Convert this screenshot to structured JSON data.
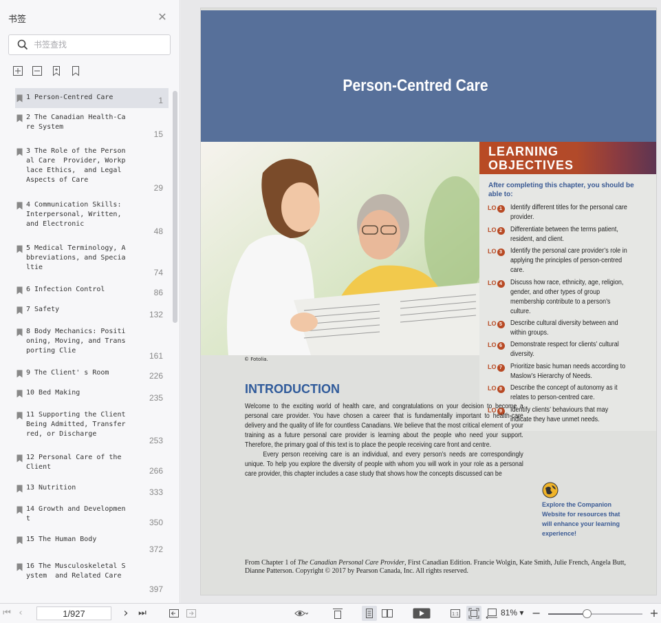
{
  "sidebar": {
    "title": "书签",
    "search_placeholder": "书签查找",
    "bookmarks": [
      {
        "label": "1 Person-Centred Care",
        "page": "1",
        "active": true,
        "h": 29
      },
      {
        "label": "2 The Canadian Health-Ca\nre System",
        "page": "15",
        "h": 49
      },
      {
        "label": "3 The Role of the Person\nal Care  Provider, Workp\nlace Ethics,  and Legal\nAspects of Care",
        "page": "29",
        "h": 78
      },
      {
        "label": "4 Communication Skills:\nInterpersonal, Written,\nand Electronic",
        "page": "48",
        "h": 63
      },
      {
        "label": "5 Medical Terminology, A\nbbreviations, and Specia\nltie",
        "page": "74",
        "h": 60
      },
      {
        "label": "6 Infection Control",
        "page": "86",
        "h": 29
      },
      {
        "label": "7 Safety",
        "page": "132",
        "h": 32
      },
      {
        "label": "8 Body Mechanics: Positi\noning, Moving, and Trans\nporting Clie",
        "page": "161",
        "h": 60
      },
      {
        "label": "9 The Client' s Room",
        "page": "226",
        "h": 29
      },
      {
        "label": "10 Bed Making",
        "page": "235",
        "h": 32
      },
      {
        "label": "11 Supporting the Client\nBeing Admitted, Transfer\nred, or Discharge",
        "page": "253",
        "h": 62
      },
      {
        "label": "12 Personal Care of the\nClient",
        "page": "266",
        "h": 44
      },
      {
        "label": "13 Nutrition",
        "page": "333",
        "h": 31
      },
      {
        "label": "14 Growth and Developmen\nt",
        "page": "350",
        "h": 44
      },
      {
        "label": "15 The Human Body",
        "page": "372",
        "h": 39
      },
      {
        "label": "16 The Musculoskeletal S\nystem  and Related Care",
        "page": "397",
        "h": 58
      }
    ]
  },
  "document": {
    "title": "Person-Centred Care",
    "photo_credit": "© Fotolia.",
    "objectives": {
      "heading_line1": "LEARNING",
      "heading_line2": "OBJECTIVES",
      "intro": "After completing this chapter, you should be able to:",
      "tag": "LO",
      "items": [
        {
          "num": "1",
          "text": "Identify different titles for the personal care provider."
        },
        {
          "num": "2",
          "text": "Differentiate between the terms patient, resident, and client."
        },
        {
          "num": "3",
          "text": "Identify the personal care provider’s role in applying the principles of person-centred care."
        },
        {
          "num": "4",
          "text": "Discuss how race, ethnicity, age, religion, gender, and other types of group membership contribute to a person’s culture."
        },
        {
          "num": "5",
          "text": "Describe cultural diversity between and within groups."
        },
        {
          "num": "6",
          "text": "Demonstrate respect for clients’ cultural diversity."
        },
        {
          "num": "7",
          "text": "Prioritize basic human needs according to Maslow’s Hierarchy of Needs."
        },
        {
          "num": "8",
          "text": "Describe the concept of autonomy as it relates to person-centred care."
        },
        {
          "num": "9",
          "text": "Identify clients’ behaviours that may indicate they have unmet needs."
        }
      ]
    },
    "intro_title": "INTRODUCTION",
    "intro_p1": "Welcome to the exciting world of health care, and congratulations on your decision to become a personal care provider. You have chosen a career that is fundamentally important to health-care delivery and the quality of life for countless Canadians. We believe that the most critical element of your training as a future personal care provider is learning about the people who need your support. Therefore, the primary goal of this text is to place the people receiving care front and centre.",
    "intro_p2": "Every person receiving care is an individual, and every person’s needs are correspondingly unique. To help you explore the diversity of people with whom you will work in your role as a personal care provider, this chapter includes a case study that shows how the concepts discussed can be",
    "companion": "Explore the Companion Website for resources that will enhance your learning experience!",
    "footer_prefix": "From Chapter 1 of ",
    "footer_book": "The Canadian Personal Care Provider",
    "footer_rest": ", First Canadian Edition. Francie Wolgin, Kate Smith, Julie French, Angela Butt, Dianne Patterson. Copyright © 2017 by Pearson Canada, Inc. All rights reserved."
  },
  "toolbar": {
    "page_display": "1/927",
    "zoom": "81%",
    "zoom_fraction": 0.41
  }
}
